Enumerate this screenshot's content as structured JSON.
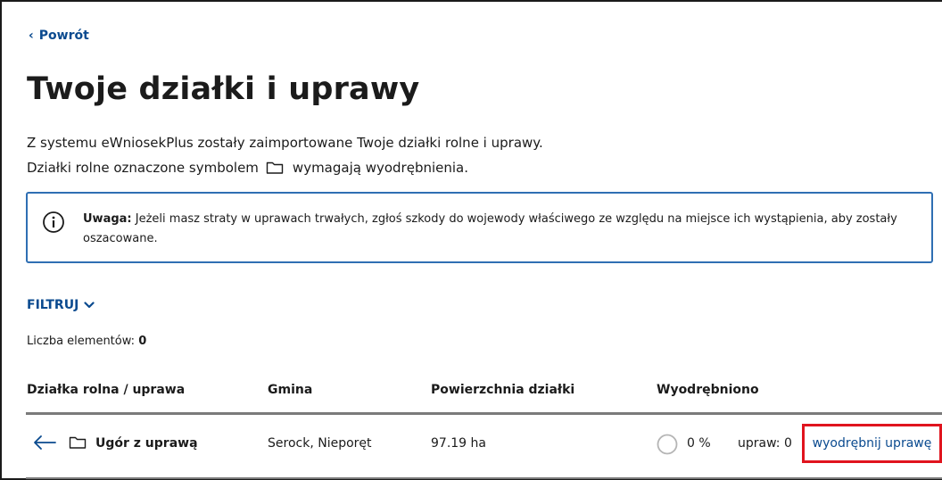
{
  "nav": {
    "back_label": "Powrót"
  },
  "page": {
    "title": "Twoje działki i uprawy",
    "intro_line1": "Z systemu eWniosekPlus zostały zaimportowane Twoje działki rolne i uprawy.",
    "intro_line2_before": "Działki rolne oznaczone symbolem",
    "intro_line2_after": "wymagają wyodrębnienia."
  },
  "notice": {
    "label": "Uwaga:",
    "text": "Jeżeli masz straty w uprawach trwałych, zgłoś szkody do wojewody właściwego ze względu na miejsce ich wystąpienia, aby zostały oszacowane."
  },
  "filter": {
    "label": "FILTRUJ"
  },
  "count": {
    "label": "Liczba elementów:",
    "value": "0"
  },
  "table": {
    "headers": [
      "Działka rolna / uprawa",
      "Gmina",
      "Powierzchnia działki",
      "Wyodrębniono"
    ],
    "rows": [
      {
        "name": "Ugór z uprawą",
        "gmina": "Serock, Nieporęt",
        "area": "97.19 ha",
        "percent": "0 %",
        "crops": "upraw: 0",
        "action": "wyodrębnij uprawę"
      }
    ]
  },
  "colors": {
    "link": "#0a4a8f",
    "notice_border": "#2f6fb3",
    "highlight": "#e0141e"
  },
  "icons": [
    "chevron-left-icon",
    "folder-icon",
    "info-icon",
    "chevron-down-icon",
    "arrow-left-icon",
    "progress-circle-icon"
  ]
}
